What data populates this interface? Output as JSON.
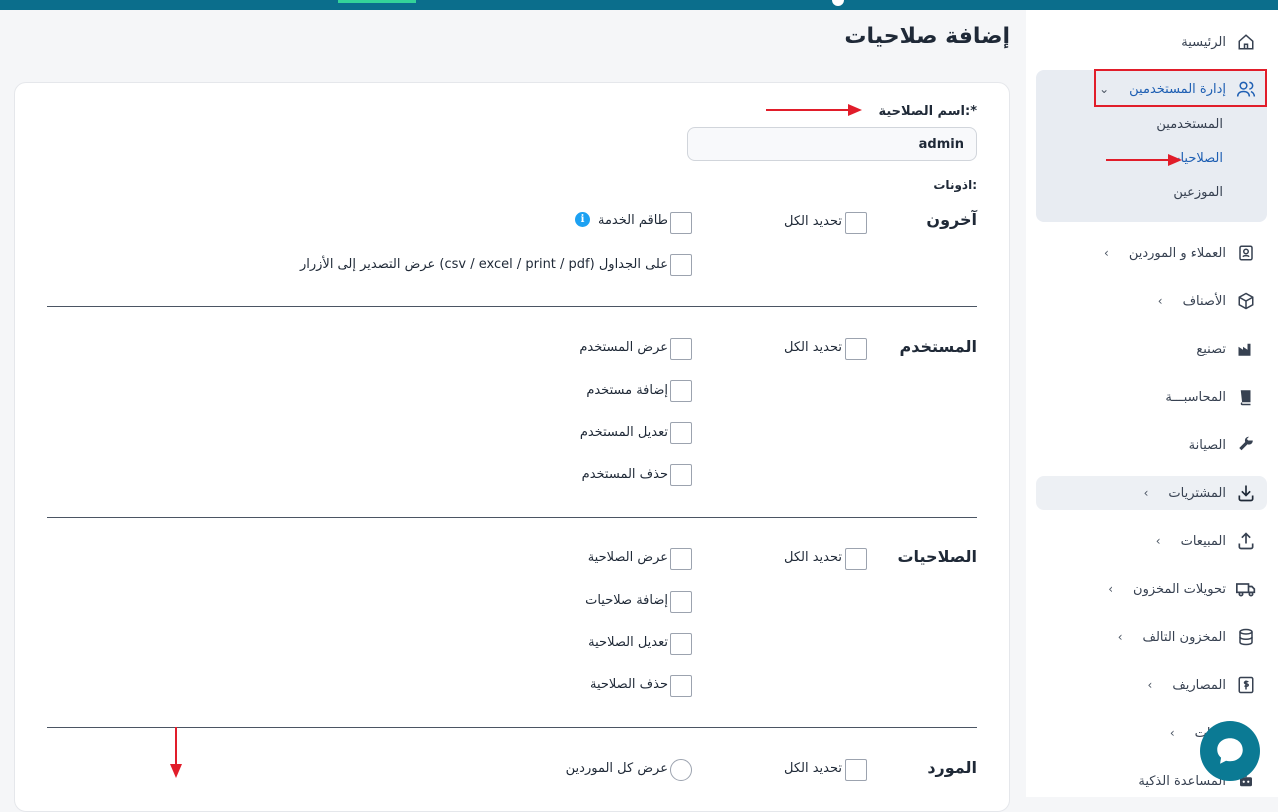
{
  "page": {
    "title": "إضافة صلاحيات",
    "role_name_label": "اسم الصلاحية:*",
    "role_name_value": "admin",
    "permissions_label": "اذونات:"
  },
  "sidebar": {
    "items": [
      {
        "label": "الرئيسية",
        "icon": "home-icon"
      },
      {
        "label": "إدارة المستخدمين",
        "icon": "users-icon"
      },
      {
        "label": "العملاء و الموردين",
        "icon": "contacts-icon"
      },
      {
        "label": "الأصناف",
        "icon": "box-icon"
      },
      {
        "label": "تصنيع",
        "icon": "factory-icon"
      },
      {
        "label": "المحاسبـــة",
        "icon": "book-icon"
      },
      {
        "label": "الصيانة",
        "icon": "wrench-icon"
      },
      {
        "label": "المشتريات",
        "icon": "download-icon"
      },
      {
        "label": "المبيعات",
        "icon": "upload-icon"
      },
      {
        "label": "تحويلات المخزون",
        "icon": "truck-icon"
      },
      {
        "label": "المخزون التالف",
        "icon": "database-icon"
      },
      {
        "label": "المصاريف",
        "icon": "dollar-icon"
      },
      {
        "label": "بيانات",
        "icon": "chart-icon"
      },
      {
        "label": "المساعدة الذكية",
        "icon": "robot-icon"
      }
    ],
    "sub_items": [
      {
        "label": "المستخدمين"
      },
      {
        "label": "الصلاحيات"
      },
      {
        "label": "الموزعين"
      }
    ]
  },
  "sections": {
    "other": {
      "title": "آخرون",
      "select_all": "تحديد الكل",
      "items": [
        "طاقم الخدمة",
        "عرض التصدير إلى الأزرار (csv / excel / print / pdf) على الجداول"
      ]
    },
    "user": {
      "title": "المستخدم",
      "select_all": "تحديد الكل",
      "items": [
        "عرض المستخدم",
        "إضافة مستخدم",
        "تعديل المستخدم",
        "حذف المستخدم"
      ]
    },
    "roles": {
      "title": "الصلاحيات",
      "select_all": "تحديد الكل",
      "items": [
        "عرض الصلاحية",
        "إضافة صلاحيات",
        "تعديل الصلاحية",
        "حذف الصلاحية"
      ]
    },
    "supplier": {
      "title": "المورد",
      "select_all": "تحديد الكل",
      "items": [
        "عرض كل الموردين"
      ]
    }
  },
  "colors": {
    "accent": "#1e5fb3",
    "annotation_red": "#e11d2a",
    "topbar": "#0b6e8c"
  }
}
